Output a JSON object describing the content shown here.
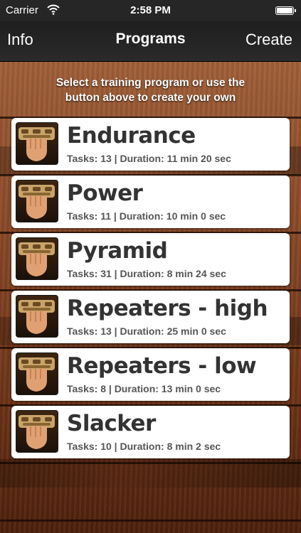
{
  "status_bar": {
    "carrier": "Carrier",
    "time": "2:58 PM"
  },
  "nav": {
    "left": "Info",
    "title": "Programs",
    "right": "Create"
  },
  "hint": {
    "line1": "Select a training program or use the",
    "line2": "button above to create your own"
  },
  "programs": [
    {
      "name": "Endurance",
      "meta": "Tasks: 13 | Duration: 11 min 20 sec"
    },
    {
      "name": "Power",
      "meta": "Tasks: 11 | Duration: 10 min 0 sec"
    },
    {
      "name": "Pyramid",
      "meta": "Tasks: 31 | Duration: 8 min 24 sec"
    },
    {
      "name": "Repeaters - high",
      "meta": "Tasks: 13 | Duration: 25 min 0 sec"
    },
    {
      "name": "Repeaters - low",
      "meta": "Tasks: 8 | Duration: 13 min 0 sec"
    },
    {
      "name": "Slacker",
      "meta": "Tasks: 10 | Duration: 8 min 2 sec"
    }
  ],
  "colors": {
    "nav_bg": "#262626",
    "wood": "#8a4a2a",
    "card": "#ffffff",
    "text": "#333333"
  }
}
